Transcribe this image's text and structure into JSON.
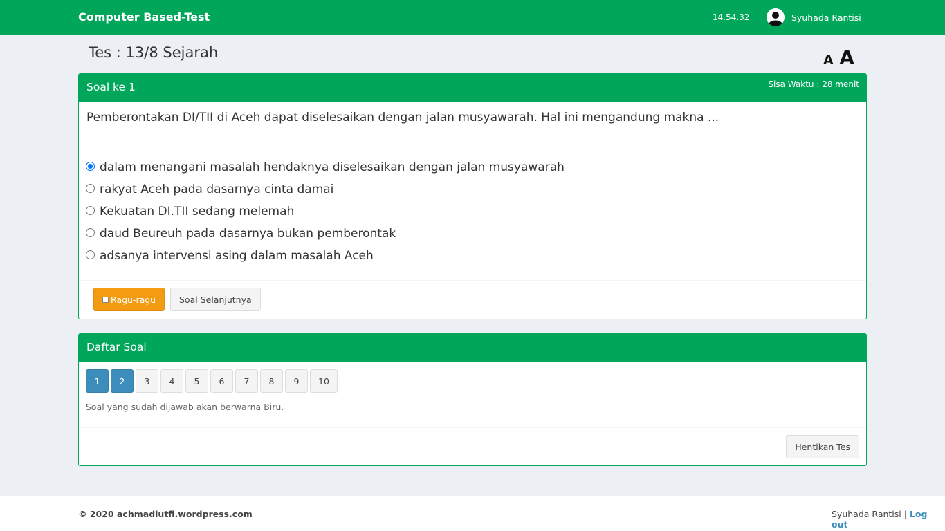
{
  "navbar": {
    "brand": "Computer Based-Test",
    "clock": "14.54.32",
    "user_name": "Syuhada Rantisi"
  },
  "page": {
    "title": "Tes : 13/8 Sejarah",
    "font_small_label": "A",
    "font_large_label": "A"
  },
  "question": {
    "header": "Soal ke 1",
    "time_left": "Sisa Waktu : 28 menit",
    "text": "Pemberontakan DI/TII di Aceh dapat diselesaikan dengan jalan musyawarah. Hal ini mengandung makna ...",
    "options": [
      {
        "label": "dalam menangani masalah hendaknya diselesaikan dengan jalan musyawarah",
        "checked": true
      },
      {
        "label": "rakyat Aceh pada dasarnya cinta damai",
        "checked": false
      },
      {
        "label": "Kekuatan DI.TII sedang melemah",
        "checked": false
      },
      {
        "label": "daud Beureuh pada dasarnya bukan pemberontak",
        "checked": false
      },
      {
        "label": "adsanya intervensi asing dalam masalah Aceh",
        "checked": false
      }
    ],
    "doubt_label": "Ragu-ragu",
    "next_label": "Soal Selanjutnya"
  },
  "question_list": {
    "header": "Daftar Soal",
    "pages": [
      {
        "label": "1",
        "answered": true
      },
      {
        "label": "2",
        "answered": true
      },
      {
        "label": "3",
        "answered": false
      },
      {
        "label": "4",
        "answered": false
      },
      {
        "label": "5",
        "answered": false
      },
      {
        "label": "6",
        "answered": false
      },
      {
        "label": "7",
        "answered": false
      },
      {
        "label": "8",
        "answered": false
      },
      {
        "label": "9",
        "answered": false
      },
      {
        "label": "10",
        "answered": false
      }
    ],
    "note": "Soal yang sudah dijawab akan berwarna Biru.",
    "stop_label": "Hentikan Tes"
  },
  "footer": {
    "copyright": "© 2020 achmadlutfi.wordpress.com",
    "user_name": "Syuhada Rantisi",
    "separator": "|",
    "logout_label": "Log out"
  },
  "colors": {
    "primary_green": "#00a65a",
    "answered_blue": "#3c8dbc",
    "warning_orange": "#f39c12",
    "radio_blue": "#0075ff"
  }
}
